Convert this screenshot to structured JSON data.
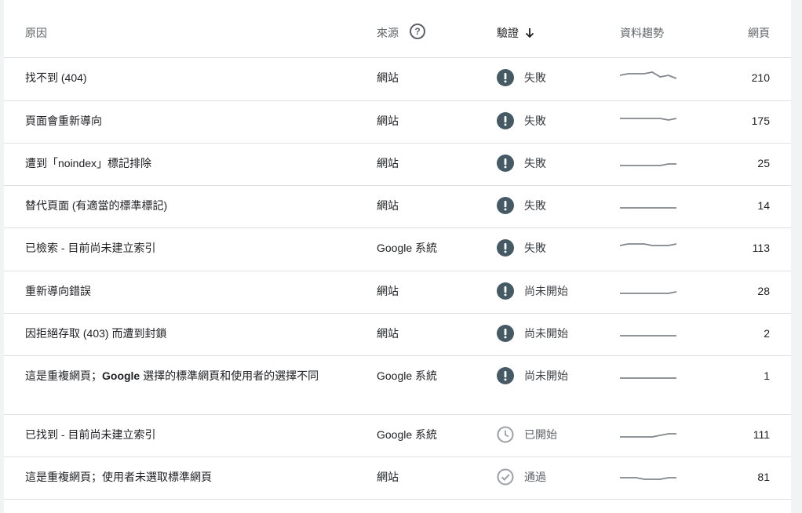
{
  "table": {
    "headers": {
      "reason": "原因",
      "source": "來源",
      "validation": "驗證",
      "trend": "資料趨勢",
      "pages": "網頁"
    },
    "rows": [
      {
        "reason": "找不到 (404)",
        "source": "網站",
        "status": "失敗",
        "status_type": "failed",
        "pages": "210",
        "trend": [
          5,
          6,
          6,
          6,
          7,
          4,
          5,
          3
        ]
      },
      {
        "reason": "頁面會重新導向",
        "source": "網站",
        "status": "失敗",
        "status_type": "failed",
        "pages": "175",
        "trend": [
          5,
          5,
          5,
          5,
          5,
          5,
          4,
          5
        ]
      },
      {
        "reason": "遭到「noindex」標記排除",
        "source": "網站",
        "status": "失敗",
        "status_type": "failed",
        "pages": "25",
        "trend": [
          2,
          2,
          2,
          2,
          2,
          2,
          3,
          3
        ]
      },
      {
        "reason": "替代頁面 (有適當的標準標記)",
        "source": "網站",
        "status": "失敗",
        "status_type": "failed",
        "pages": "14",
        "trend": [
          2,
          2,
          2,
          2,
          2,
          2,
          2,
          2
        ]
      },
      {
        "reason": "已檢索 - 目前尚未建立索引",
        "source": "Google 系統",
        "status": "失敗",
        "status_type": "failed",
        "pages": "113",
        "trend": [
          5,
          6,
          6,
          6,
          5,
          5,
          5,
          6
        ]
      },
      {
        "reason": "重新導向錯誤",
        "source": "網站",
        "status": "尚未開始",
        "status_type": "not_started",
        "pages": "28",
        "trend": [
          2,
          2,
          2,
          2,
          2,
          2,
          2,
          3
        ]
      },
      {
        "reason": "因拒絕存取 (403) 而遭到封鎖",
        "source": "網站",
        "status": "尚未開始",
        "status_type": "not_started",
        "pages": "2",
        "trend": [
          2,
          2,
          2,
          2,
          2,
          2,
          2,
          2
        ]
      },
      {
        "reason_parts": [
          "這是重複網頁；",
          "Google",
          " 選擇的標準網頁和使用者的選擇不同"
        ],
        "source": "Google 系統",
        "status": "尚未開始",
        "status_type": "not_started",
        "pages": "1",
        "trend": [
          2,
          2,
          2,
          2,
          2,
          2,
          2,
          2
        ]
      },
      {
        "reason": "已找到 - 目前尚未建立索引",
        "source": "Google 系統",
        "status": "已開始",
        "status_type": "started",
        "pages": "111",
        "trend": [
          2,
          2,
          2,
          2,
          2,
          3,
          4,
          4
        ]
      },
      {
        "reason": "這是重複網頁；使用者未選取標準網頁",
        "source": "網站",
        "status": "通過",
        "status_type": "passed",
        "pages": "81",
        "trend": [
          3,
          3,
          3,
          2,
          2,
          2,
          3,
          3
        ]
      }
    ]
  },
  "colors": {
    "failed_icon": "#455a64",
    "muted_icon": "#9aa0a6",
    "sparkline": "#80868b"
  },
  "icons": {
    "failed": "error-icon",
    "not_started": "error-icon",
    "started": "clock-icon",
    "passed": "check-circle-icon"
  }
}
